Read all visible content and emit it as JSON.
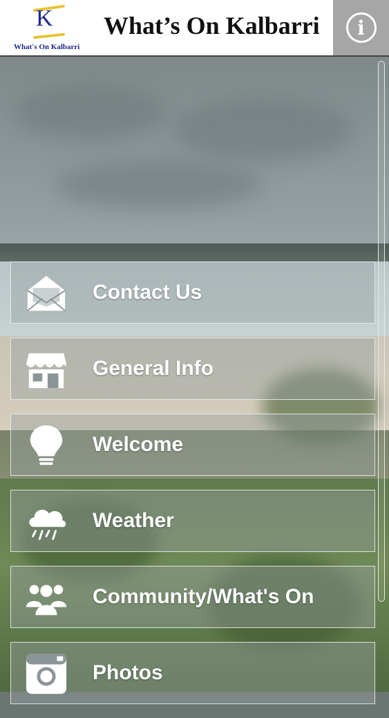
{
  "header": {
    "logo_letter": "K",
    "logo_subtitle": "What's On Kalbarri",
    "title": "What’s On Kalbarri",
    "info_icon": "info-icon",
    "info_glyph": "i"
  },
  "menu": {
    "items": [
      {
        "label": "Contact Us",
        "icon": "envelope-icon"
      },
      {
        "label": "General Info",
        "icon": "storefront-icon"
      },
      {
        "label": "Welcome",
        "icon": "lightbulb-icon"
      },
      {
        "label": "Weather",
        "icon": "rain-cloud-icon"
      },
      {
        "label": "Community/What's On",
        "icon": "people-group-icon"
      },
      {
        "label": "Photos",
        "icon": "instagram-camera-icon"
      }
    ]
  },
  "colors": {
    "header_bg": "#ffffff",
    "info_button_bg": "#a6a6a6",
    "logo_blue": "#1c2a8c",
    "logo_gold": "#e6c233",
    "menu_text": "#ffffff"
  }
}
